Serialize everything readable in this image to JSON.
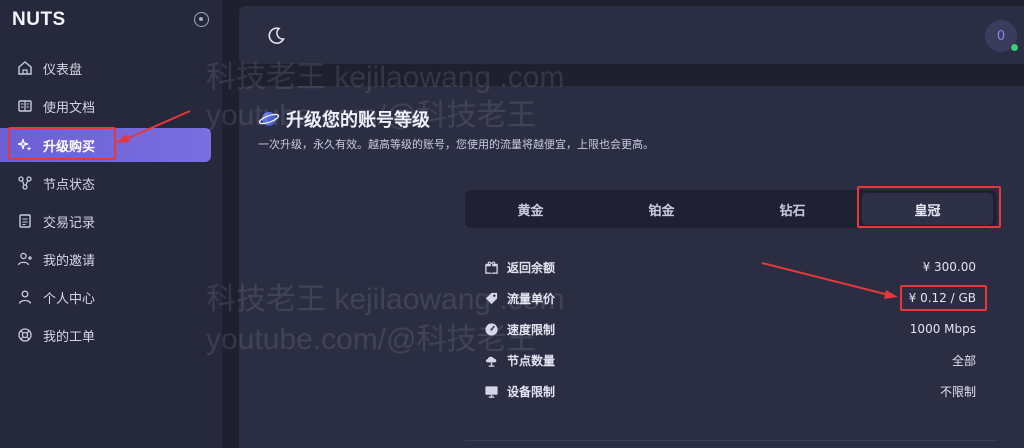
{
  "app": {
    "name": "NUTS"
  },
  "sidebar": {
    "items": [
      {
        "label": "仪表盘",
        "icon": "home-icon"
      },
      {
        "label": "使用文档",
        "icon": "book-icon"
      },
      {
        "label": "升级购买",
        "icon": "sparkle-icon",
        "active": true
      },
      {
        "label": "节点状态",
        "icon": "nodes-icon"
      },
      {
        "label": "交易记录",
        "icon": "receipt-icon"
      },
      {
        "label": "我的邀请",
        "icon": "user-add-icon"
      },
      {
        "label": "个人中心",
        "icon": "user-icon"
      },
      {
        "label": "我的工单",
        "icon": "lifebuoy-icon"
      }
    ]
  },
  "topbar": {
    "theme_icon": "moon-icon",
    "avatar_label": "0"
  },
  "upgrade": {
    "title": "升级您的账号等级",
    "subtitle": "一次升级，永久有效。越高等级的账号，您使用的流量将越便宜，上限也会更高。",
    "tabs": [
      {
        "label": "黄金"
      },
      {
        "label": "铂金"
      },
      {
        "label": "钻石"
      },
      {
        "label": "皇冠",
        "active": true
      }
    ],
    "rows": [
      {
        "label": "返回余额",
        "value": "¥ 300.00",
        "icon": "gift-icon"
      },
      {
        "label": "流量单价",
        "value": "¥ 0.12 / GB",
        "icon": "tag-icon"
      },
      {
        "label": "速度限制",
        "value": "1000 Mbps",
        "icon": "speedometer-icon"
      },
      {
        "label": "节点数量",
        "value": "全部",
        "icon": "cloud-icon"
      },
      {
        "label": "设备限制",
        "value": "不限制",
        "icon": "monitor-icon"
      }
    ]
  },
  "watermarks": [
    "科技老王 kejilaowang .com",
    "youtube.com/@科技老王"
  ],
  "colors": {
    "accent": "#6b5fd3",
    "highlight": "#e53838",
    "online": "#38d17a"
  }
}
